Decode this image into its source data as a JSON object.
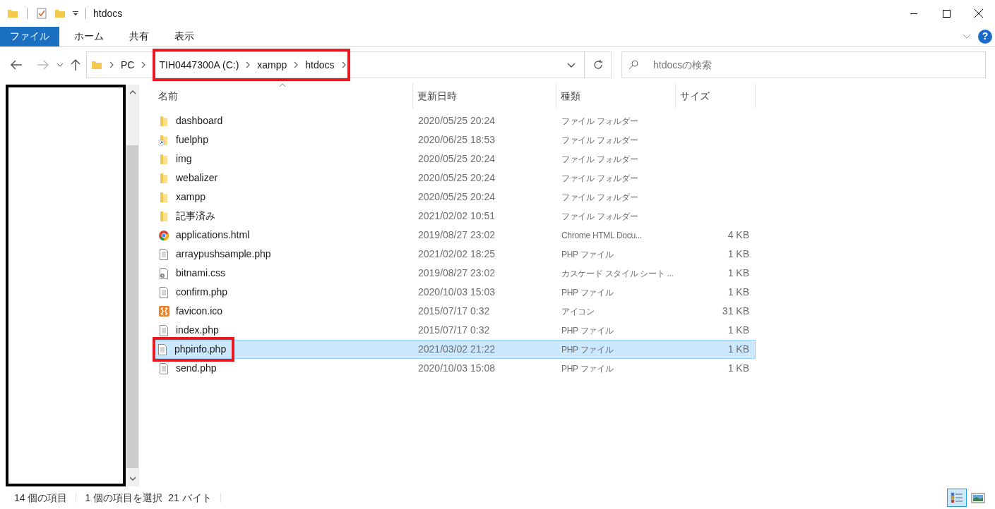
{
  "window": {
    "title": "htdocs"
  },
  "ribbon_tabs": [
    {
      "label": "ファイル",
      "kind": "file"
    },
    {
      "label": "ホーム",
      "kind": "tab"
    },
    {
      "label": "共有",
      "kind": "tab"
    },
    {
      "label": "表示",
      "kind": "tab"
    }
  ],
  "help_button": {
    "label": "?"
  },
  "address_bar": {
    "crumbs": [
      {
        "label": "PC",
        "highlighted": false
      },
      {
        "label": "TIH0447300A (C:)",
        "highlighted": true
      },
      {
        "label": "xampp",
        "highlighted": true
      },
      {
        "label": "htdocs",
        "highlighted": true
      }
    ]
  },
  "search": {
    "placeholder": "htdocsの検索"
  },
  "table": {
    "columns": [
      "名前",
      "更新日時",
      "種類",
      "サイズ"
    ],
    "rows": [
      {
        "kind": "folder",
        "name": "dashboard",
        "modified": "2020/05/25 20:24",
        "type": "ファイル フォルダー",
        "size": "",
        "selected": false,
        "highlighted": false
      },
      {
        "kind": "folder_shortcut",
        "name": "fuelphp",
        "modified": "2020/06/25 18:53",
        "type": "ファイル フォルダー",
        "size": "",
        "selected": false,
        "highlighted": false
      },
      {
        "kind": "folder",
        "name": "img",
        "modified": "2020/05/25 20:24",
        "type": "ファイル フォルダー",
        "size": "",
        "selected": false,
        "highlighted": false
      },
      {
        "kind": "folder",
        "name": "webalizer",
        "modified": "2020/05/25 20:24",
        "type": "ファイル フォルダー",
        "size": "",
        "selected": false,
        "highlighted": false
      },
      {
        "kind": "folder",
        "name": "xampp",
        "modified": "2020/05/25 20:24",
        "type": "ファイル フォルダー",
        "size": "",
        "selected": false,
        "highlighted": false
      },
      {
        "kind": "folder",
        "name": "記事済み",
        "modified": "2021/02/02 10:51",
        "type": "ファイル フォルダー",
        "size": "",
        "selected": false,
        "highlighted": false
      },
      {
        "kind": "chrome",
        "name": "applications.html",
        "modified": "2019/08/27 23:02",
        "type": "Chrome HTML Docu...",
        "size": "4 KB",
        "selected": false,
        "highlighted": false
      },
      {
        "kind": "document",
        "name": "arraypushsample.php",
        "modified": "2021/02/02 18:25",
        "type": "PHP ファイル",
        "size": "1 KB",
        "selected": false,
        "highlighted": false
      },
      {
        "kind": "stylesheet",
        "name": "bitnami.css",
        "modified": "2019/08/27 23:02",
        "type": "カスケード スタイル シート ...",
        "size": "1 KB",
        "selected": false,
        "highlighted": false
      },
      {
        "kind": "document",
        "name": "confirm.php",
        "modified": "2020/10/03 15:03",
        "type": "PHP ファイル",
        "size": "1 KB",
        "selected": false,
        "highlighted": false
      },
      {
        "kind": "xampp",
        "name": "favicon.ico",
        "modified": "2015/07/17 0:32",
        "type": "アイコン",
        "size": "31 KB",
        "selected": false,
        "highlighted": false
      },
      {
        "kind": "document",
        "name": "index.php",
        "modified": "2015/07/17 0:32",
        "type": "PHP ファイル",
        "size": "1 KB",
        "selected": false,
        "highlighted": false
      },
      {
        "kind": "document",
        "name": "phpinfo.php",
        "modified": "2021/03/02 21:22",
        "type": "PHP ファイル",
        "size": "1 KB",
        "selected": true,
        "highlighted": true
      },
      {
        "kind": "document",
        "name": "send.php",
        "modified": "2020/10/03 15:08",
        "type": "PHP ファイル",
        "size": "1 KB",
        "selected": false,
        "highlighted": false
      }
    ]
  },
  "status_bar": {
    "item_count": "14 個の項目",
    "selection": "1 個の項目を選択",
    "selection_size": "21 バイト"
  },
  "view_buttons": [
    {
      "kind": "details",
      "selected": true
    },
    {
      "kind": "large_icons",
      "selected": false
    }
  ]
}
